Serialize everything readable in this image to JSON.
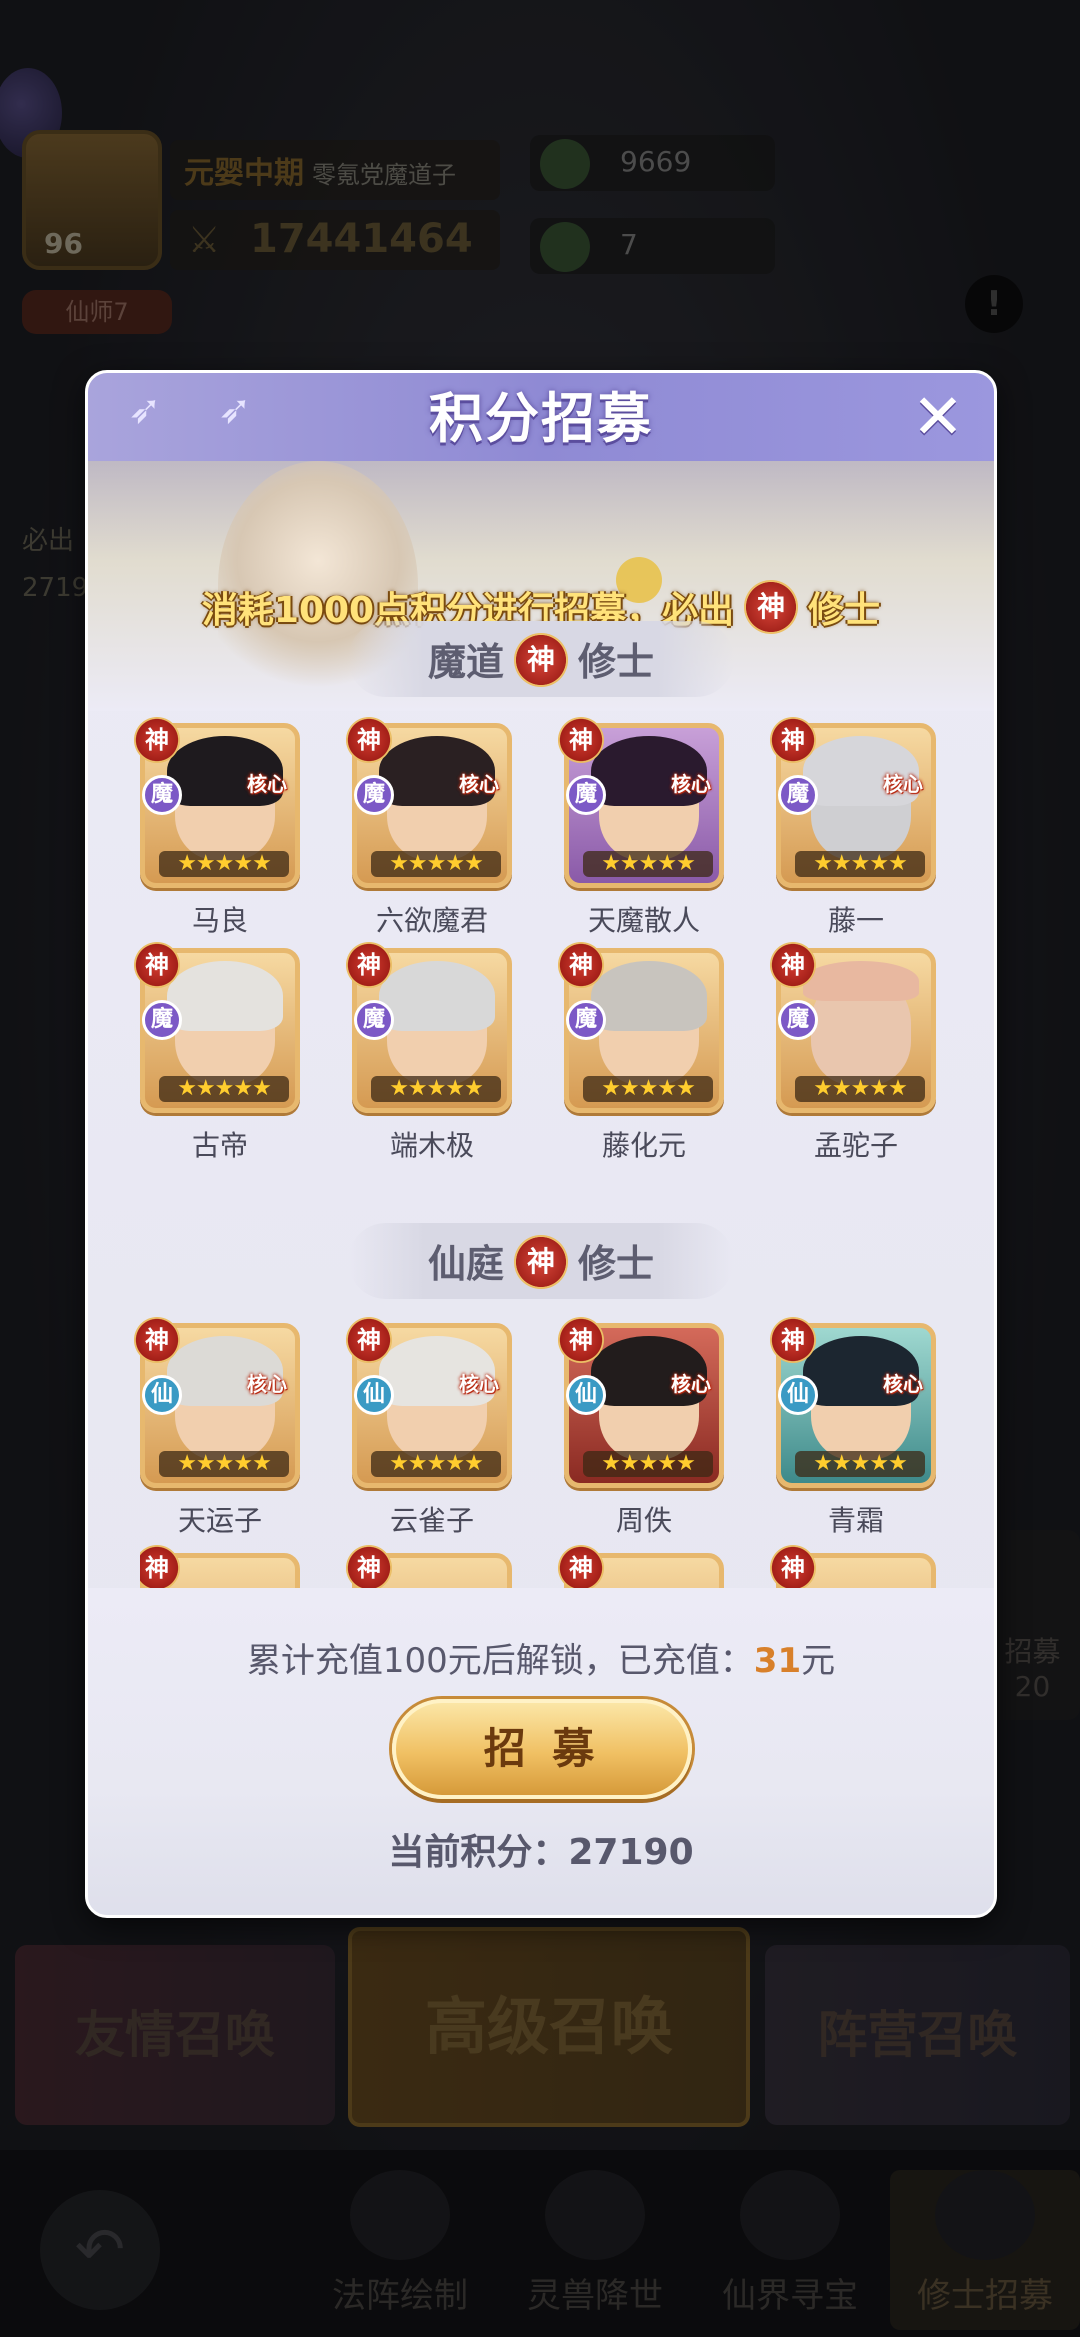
{
  "background": {
    "player_level": "96",
    "realm": "元婴中期",
    "sect_name": "零氪党魔道子",
    "power": "17441464",
    "resource1": "9669",
    "resource2": "7",
    "title_tag": "仙师7",
    "left_side_text": "必出",
    "left_side_points": "2719",
    "right_side_text": "招募",
    "right_side_num": "20",
    "cards": [
      "友情召唤",
      "高级召唤",
      "阵营召唤"
    ],
    "nav": [
      "法阵绘制",
      "灵兽降世",
      "仙界寻宝",
      "修士招募"
    ]
  },
  "modal": {
    "title": "积分招募",
    "banner_before": "消耗1000点积分进行招募，必出",
    "banner_badge": "神",
    "banner_after": "修士",
    "section1": {
      "left": "魔道",
      "badge": "神",
      "right": "修士"
    },
    "section2": {
      "left": "仙庭",
      "badge": "神",
      "right": "修士"
    },
    "god_badge": "神",
    "faction_mo": "魔",
    "faction_xian": "仙",
    "core_label": "核心",
    "stars": "★★★★★",
    "demon_heroes": [
      {
        "name": "马良",
        "core": true
      },
      {
        "name": "六欲魔君",
        "core": true
      },
      {
        "name": "天魔散人",
        "core": true
      },
      {
        "name": "藤一",
        "core": true
      },
      {
        "name": "古帝",
        "core": false
      },
      {
        "name": "端木极",
        "core": false
      },
      {
        "name": "藤化元",
        "core": false
      },
      {
        "name": "孟驼子",
        "core": false
      }
    ],
    "immortal_heroes": [
      {
        "name": "天运子",
        "core": true
      },
      {
        "name": "云雀子",
        "core": true
      },
      {
        "name": "周佚",
        "core": true
      },
      {
        "name": "青霜",
        "core": true
      }
    ],
    "unlock_before": "累计充值100元后解锁，已充值：",
    "unlock_paid": "31",
    "unlock_unit": "元",
    "recruit_label": "招 募",
    "points_label": "当前积分：",
    "points_value": "27190"
  }
}
